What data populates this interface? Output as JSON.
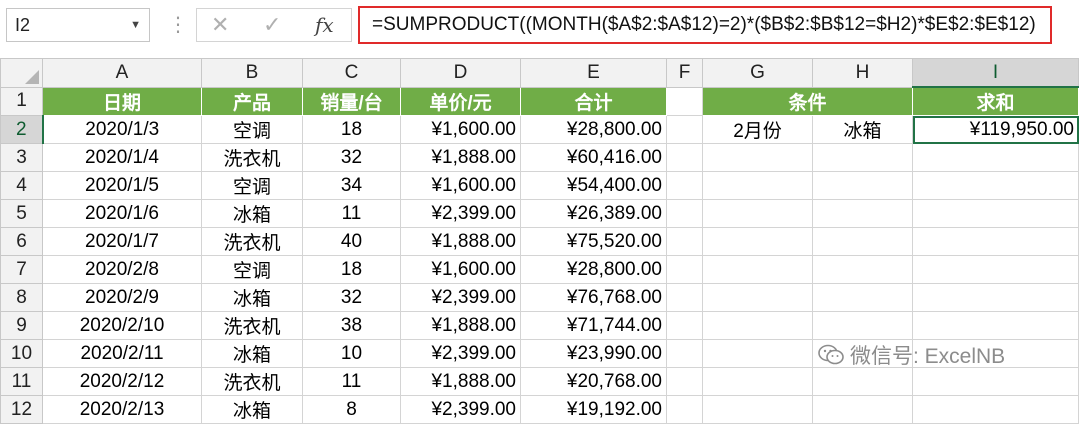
{
  "formula_bar": {
    "name_box": "I2",
    "formula": "=SUMPRODUCT((MONTH($A$2:$A$12)=2)*($B$2:$B$12=$H2)*$E$2:$E$12)",
    "icons": [
      "cancel-icon",
      "enter-icon",
      "fx-icon"
    ]
  },
  "columns": [
    "A",
    "B",
    "C",
    "D",
    "E",
    "F",
    "G",
    "H",
    "I"
  ],
  "rows": [
    "1",
    "2",
    "3",
    "4",
    "5",
    "6",
    "7",
    "8",
    "9",
    "10",
    "11",
    "12"
  ],
  "headers": {
    "date": "日期",
    "product": "产品",
    "qty": "销量/台",
    "price": "单价/元",
    "total": "合计",
    "condition": "条件",
    "sum": "求和"
  },
  "data": [
    [
      "2020/1/3",
      "空调",
      "18",
      "¥1,600.00",
      "¥28,800.00"
    ],
    [
      "2020/1/4",
      "洗衣机",
      "32",
      "¥1,888.00",
      "¥60,416.00"
    ],
    [
      "2020/1/5",
      "空调",
      "34",
      "¥1,600.00",
      "¥54,400.00"
    ],
    [
      "2020/1/6",
      "冰箱",
      "11",
      "¥2,399.00",
      "¥26,389.00"
    ],
    [
      "2020/1/7",
      "洗衣机",
      "40",
      "¥1,888.00",
      "¥75,520.00"
    ],
    [
      "2020/2/8",
      "空调",
      "18",
      "¥1,600.00",
      "¥28,800.00"
    ],
    [
      "2020/2/9",
      "冰箱",
      "32",
      "¥2,399.00",
      "¥76,768.00"
    ],
    [
      "2020/2/10",
      "洗衣机",
      "38",
      "¥1,888.00",
      "¥71,744.00"
    ],
    [
      "2020/2/11",
      "冰箱",
      "10",
      "¥2,399.00",
      "¥23,990.00"
    ],
    [
      "2020/2/12",
      "洗衣机",
      "11",
      "¥1,888.00",
      "¥20,768.00"
    ],
    [
      "2020/2/13",
      "冰箱",
      "8",
      "¥2,399.00",
      "¥19,192.00"
    ]
  ],
  "criteria": {
    "month": "2月份",
    "product": "冰箱",
    "result": "¥119,950.00"
  },
  "active_cell": "I2",
  "watermark": "微信号: ExcelNB",
  "colors": {
    "header_green": "#70ad47",
    "formula_border": "#e02a2a",
    "selection": "#217346"
  }
}
